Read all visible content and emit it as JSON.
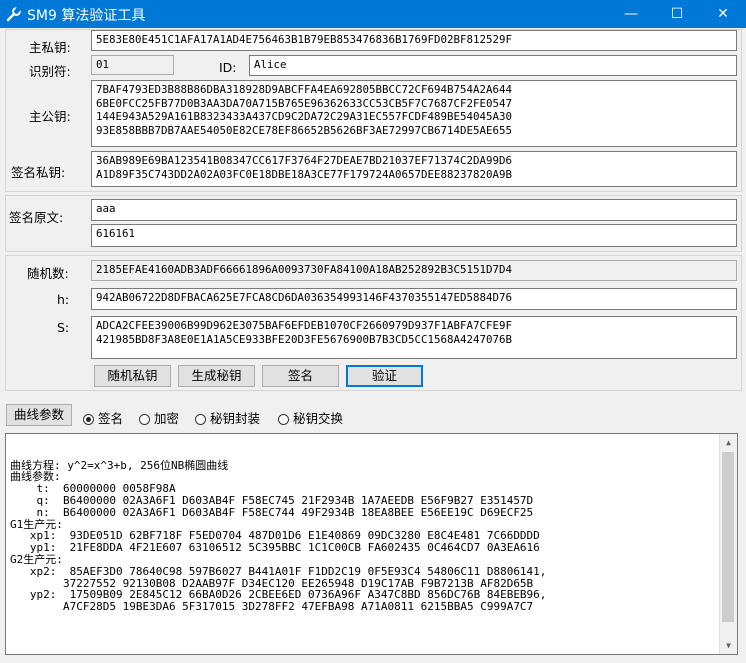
{
  "window": {
    "title": "SM9 算法验证工具",
    "min": "—",
    "max": "☐",
    "close": "✕"
  },
  "keys": {
    "master_private_label": "主私钥:",
    "master_private": "5E83E80E451C1AFA17A1AD4E756463B1B79EB853476836B1769FD02BF812529F",
    "hid_label": "识别符:",
    "hid": "01",
    "id_label": "ID:",
    "id": "Alice",
    "master_public_label": "主公钥:",
    "master_public": "7BAF4793ED3B88B86DBA318928D9ABCFFA4EA692805BBCC72CF694B754A2A644\n6BE0FCC25FB77D0B3AA3DA70A715B765E96362633CC53CB5F7C7687CF2FE0547\n144E943A529A161B8323433A437CD9C2DA72C29A31EC557FCDF489BE54045A30\n93E858BBB7DB7AAE54050E82CE78EF86652B5626BF3AE72997CB6714DE5AE655",
    "sign_private_label": "签名私钥:",
    "sign_private": "36AB989E69BA123541B08347CC617F3764F27DEAE7BD21037EF71374C2DA99D6\nA1D89F35C743DD2A02A03FC0E18DBE18A3CE77F179724A0657DEE88237820A9B"
  },
  "message": {
    "label": "签名原文:",
    "text": "aaa",
    "hex": "616161"
  },
  "sign": {
    "random_label": "随机数:",
    "random": "2185EFAE4160ADB3ADF66661896A0093730FA84100A18AB252892B3C5151D7D4",
    "h_label": "h:",
    "h": "942AB06722D8DFBACA625E7FCA8CD6DA036354993146F4370355147ED5884D76",
    "s_label": "S:",
    "s": "ADCA2CFEE39006B99D962E3075BAF6EFDEB1070CF2660979D937F1ABFA7CFE9F\n421985BD8F3A8E0E1A1A5CE933BFE20D3FE5676900B7B3CD5CC1568A4247076B"
  },
  "buttons": {
    "random_key": "随机私钥",
    "gen_key": "生成秘钥",
    "sign": "签名",
    "verify": "验证"
  },
  "mode": {
    "curve_params_button": "曲线参数",
    "options": [
      {
        "label": "签名",
        "selected": true
      },
      {
        "label": "加密",
        "selected": false
      },
      {
        "label": "秘钥封装",
        "selected": false
      },
      {
        "label": "秘钥交换",
        "selected": false
      }
    ]
  },
  "output": {
    "text": "曲线方程: y^2=x^3+b, 256位NB椭圆曲线\n曲线参数:\n    t:  60000000 0058F98A\n    q:  B6400000 02A3A6F1 D603AB4F F58EC745 21F2934B 1A7AEEDB E56F9B27 E351457D\n    n:  B6400000 02A3A6F1 D603AB4F F58EC744 49F2934B 18EA8BEE E56EE19C D69ECF25\nG1生产元:\n   xp1:  93DE051D 62BF718F F5ED0704 487D01D6 E1E40869 09DC3280 E8C4E481 7C66DDDD\n   yp1:  21FE8DDA 4F21E607 63106512 5C395BBC 1C1C00CB FA602435 0C464CD7 0A3EA616\nG2生产元:\n   xp2:  85AEF3D0 78640C98 597B6027 B441A01F F1DD2C19 0F5E93C4 54806C11 D8806141,\n        37227552 92130B08 D2AAB97F D34EC120 EE265948 D19C17AB F9B7213B AF82D65B\n   yp2:  17509B09 2E845C12 66BA0D26 2CBEE6ED 0736A96F A347C8BD 856DC76B 84EBEB96,\n        A7CF28D5 19BE3DA6 5F317015 3D278FF2 47EFBA98 A71A0811 6215BBA5 C999A7C7"
  }
}
